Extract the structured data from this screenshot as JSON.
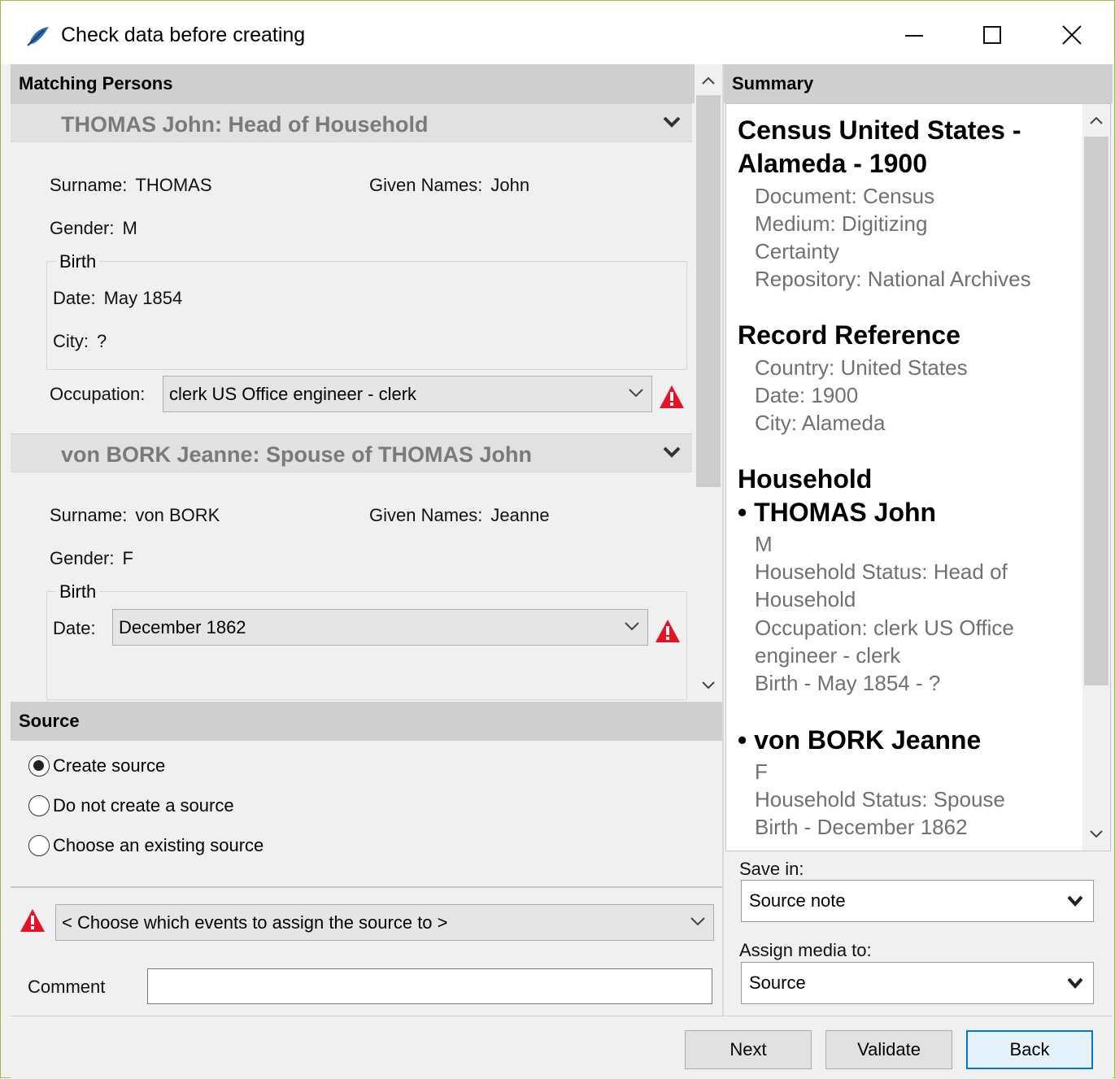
{
  "window": {
    "title": "Check data before creating"
  },
  "matching": {
    "header": "Matching Persons",
    "persons": [
      {
        "title": "THOMAS John: Head of Household",
        "surname_label": "Surname:",
        "surname": "THOMAS",
        "given_label": "Given Names:",
        "given": "John",
        "gender_label": "Gender:",
        "gender": "M",
        "birth_legend": "Birth",
        "date_label": "Date:",
        "date": "May 1854",
        "city_label": "City:",
        "city": "?",
        "occupation_label": "Occupation:",
        "occupation": "clerk US Office engineer - clerk"
      },
      {
        "title": "von BORK Jeanne: Spouse of THOMAS John",
        "surname_label": "Surname:",
        "surname": "von BORK",
        "given_label": "Given Names:",
        "given": "Jeanne",
        "gender_label": "Gender:",
        "gender": "F",
        "birth_legend": "Birth",
        "date_label": "Date:",
        "date": "December 1862"
      }
    ]
  },
  "source": {
    "header": "Source",
    "options": [
      "Create source",
      "Do not create a source",
      "Choose an existing source"
    ],
    "selected": 0,
    "events_select": "< Choose which events to assign the source to >",
    "comment_label": "Comment",
    "comment_value": ""
  },
  "summary": {
    "header": "Summary",
    "census_title_1": "Census United States -",
    "census_title_2": "Alameda - 1900",
    "document": "Document: Census",
    "medium": "Medium: Digitizing",
    "certainty": "Certainty",
    "repository": "Repository: National Archives",
    "record_ref_title": "Record Reference",
    "country": "Country: United States",
    "date": "Date: 1900",
    "city": "City: Alameda",
    "household_title": "Household",
    "p1_name": "• THOMAS John",
    "p1_gender": "M",
    "p1_status_1": "Household Status: Head of",
    "p1_status_2": "Household",
    "p1_occ_1": "Occupation: clerk US Office",
    "p1_occ_2": "engineer - clerk",
    "p1_birth": "Birth - May 1854 - ?",
    "p2_name": "• von BORK Jeanne",
    "p2_gender": "F",
    "p2_status": "Household Status: Spouse",
    "p2_birth": "Birth - December 1862"
  },
  "save_in": {
    "label": "Save in:",
    "value": "Source note"
  },
  "assign_media": {
    "label": "Assign media to:",
    "value": "Source"
  },
  "buttons": {
    "next": "Next",
    "validate": "Validate",
    "back": "Back"
  },
  "colors": {
    "warning": "#e81123",
    "focus": "#0078d7",
    "header_bg": "#cfcfcf"
  }
}
